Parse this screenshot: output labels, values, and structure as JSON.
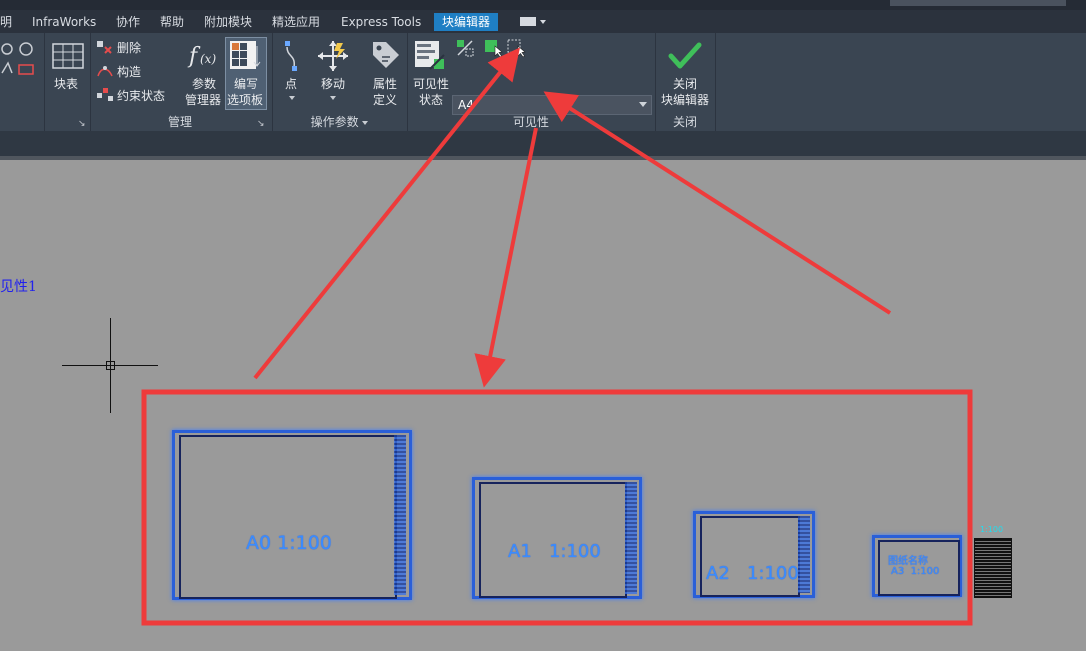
{
  "menu": {
    "items": [
      "明",
      "InfraWorks",
      "协作",
      "帮助",
      "附加模块",
      "精选应用",
      "Express Tools",
      "块编辑器"
    ],
    "active_index": 7
  },
  "ribbon": {
    "delete_label": "删除",
    "construct_label": "构造",
    "constraint_state_label": "约束状态",
    "block_table_label": "块表",
    "param_manager_label1": "参数",
    "param_manager_label2": "管理器",
    "authoring_palette_label1": "编写",
    "authoring_palette_label2": "选项板",
    "point_label": "点",
    "move_label": "移动",
    "attr_def_label1": "属性",
    "attr_def_label2": "定义",
    "vis_state_label1": "可见性",
    "vis_state_label2": "状态",
    "vis_dropdown_value": "A4",
    "close_label1": "关闭",
    "close_label2": "块编辑器",
    "panels": {
      "manage": "管理",
      "action_params": "操作参数",
      "visibility": "可见性",
      "close": "关闭"
    }
  },
  "canvas": {
    "visibility_param_label": "见性1",
    "frames": [
      {
        "paper": "A0",
        "scale": "1:100"
      },
      {
        "paper": "A1",
        "scale": "1:100"
      },
      {
        "paper": "A2",
        "scale": "1:100"
      },
      {
        "paper": "A3",
        "scale": "1:100",
        "extra": "图纸名称"
      }
    ],
    "small_label": "1:100"
  },
  "colors": {
    "annotation_red": "#ee3b3b",
    "frame_blue": "#2a5fd8",
    "check_green": "#3fbf5a"
  }
}
